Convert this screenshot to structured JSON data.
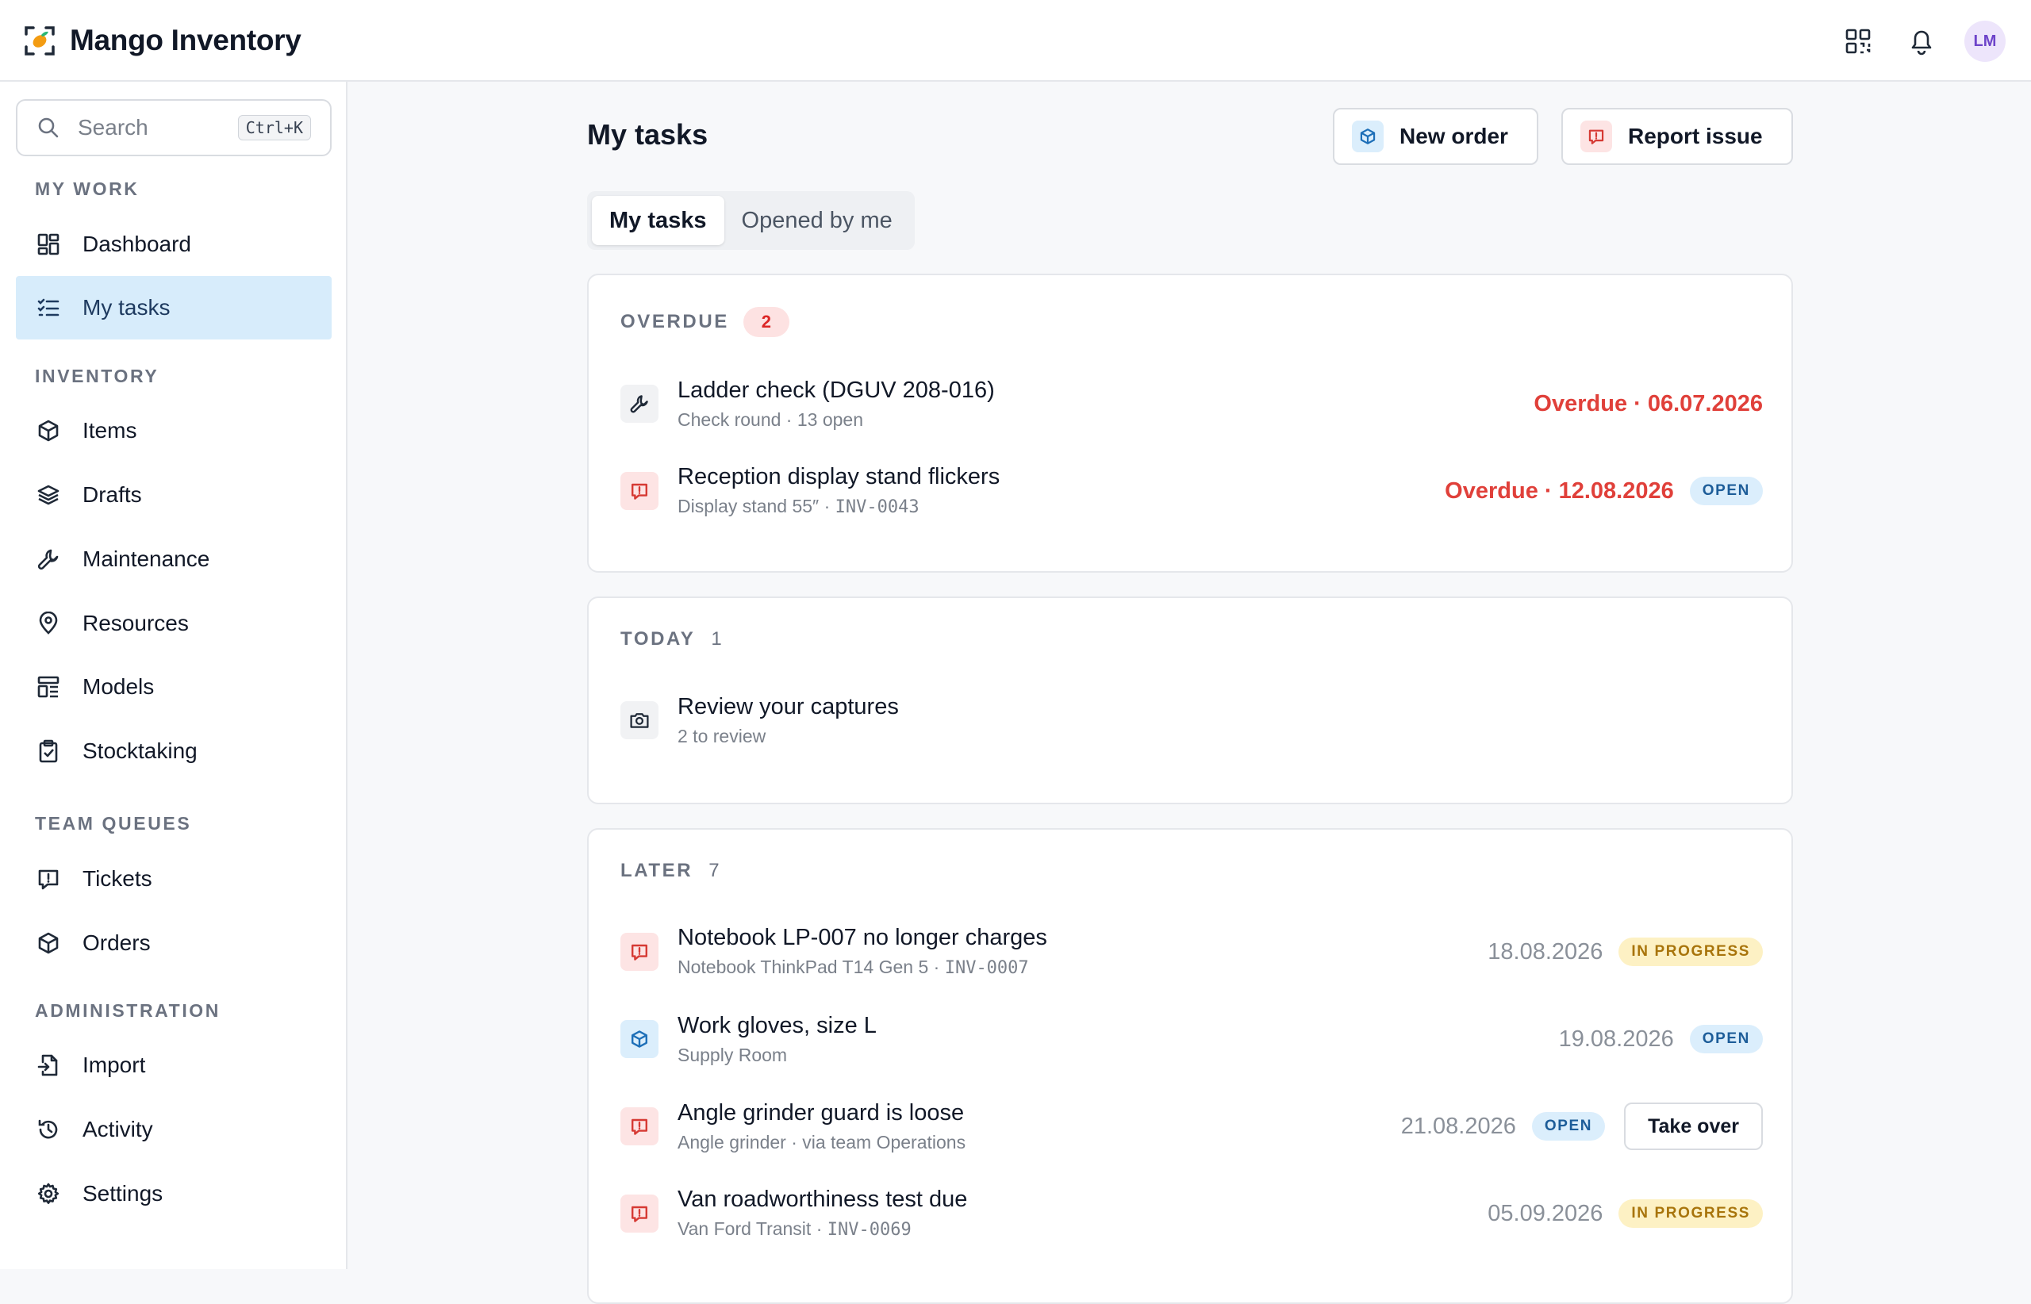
{
  "app": {
    "name": "Mango Inventory",
    "avatar_initials": "LM"
  },
  "topbar": {
    "icons": [
      "qr-code-icon",
      "bell-icon"
    ]
  },
  "sidebar": {
    "search": {
      "placeholder": "Search",
      "shortcut": "Ctrl+K"
    },
    "sections": [
      {
        "title": "MY WORK",
        "items": [
          {
            "label": "Dashboard",
            "icon": "dashboard-icon"
          },
          {
            "label": "My tasks",
            "icon": "tasklist-icon",
            "active": true
          }
        ]
      },
      {
        "title": "INVENTORY",
        "items": [
          {
            "label": "Items",
            "icon": "box-icon"
          },
          {
            "label": "Drafts",
            "icon": "layers-icon"
          },
          {
            "label": "Maintenance",
            "icon": "wrench-icon"
          },
          {
            "label": "Resources",
            "icon": "location-pin-icon"
          },
          {
            "label": "Models",
            "icon": "template-icon"
          },
          {
            "label": "Stocktaking",
            "icon": "clipboard-check-icon"
          }
        ]
      },
      {
        "title": "TEAM QUEUES",
        "items": [
          {
            "label": "Tickets",
            "icon": "message-alert-icon"
          },
          {
            "label": "Orders",
            "icon": "box-icon"
          }
        ]
      },
      {
        "title": "ADMINISTRATION",
        "items": [
          {
            "label": "Import",
            "icon": "file-import-icon"
          },
          {
            "label": "Activity",
            "icon": "history-icon"
          },
          {
            "label": "Settings",
            "icon": "gear-icon"
          }
        ]
      }
    ]
  },
  "main": {
    "title": "My tasks",
    "actions": {
      "new_order": "New order",
      "report_issue": "Report issue"
    },
    "tabs": [
      {
        "label": "My tasks",
        "active": true
      },
      {
        "label": "Opened by me",
        "active": false
      }
    ],
    "groups": {
      "overdue": {
        "label": "OVERDUE",
        "count": "2",
        "tasks": [
          {
            "title": "Ladder check (DGUV 208-016)",
            "subtitle": "Check round · 13 open",
            "due": "Overdue · 06.07.2026",
            "icon": "wrench-icon"
          },
          {
            "title": "Reception display stand flickers",
            "subtitle_text": "Display stand 55″ · ",
            "subtitle_code": "INV-0043",
            "due": "Overdue · 12.08.2026",
            "status": "OPEN",
            "icon": "message-alert-icon"
          }
        ]
      },
      "today": {
        "label": "TODAY",
        "count": "1",
        "tasks": [
          {
            "title": "Review your captures",
            "subtitle": "2 to review",
            "icon": "camera-icon"
          }
        ]
      },
      "later": {
        "label": "LATER",
        "count": "7",
        "tasks": [
          {
            "title": "Notebook LP-007 no longer charges",
            "subtitle_text": "Notebook ThinkPad T14 Gen 5 · ",
            "subtitle_code": "INV-0007",
            "due": "18.08.2026",
            "status": "IN PROGRESS",
            "icon": "message-alert-icon"
          },
          {
            "title": "Work gloves, size L",
            "subtitle": "Supply Room",
            "due": "19.08.2026",
            "status": "OPEN",
            "icon": "box-icon"
          },
          {
            "title": "Angle grinder guard is loose",
            "subtitle": "Angle grinder · via team Operations",
            "due": "21.08.2026",
            "status": "OPEN",
            "action": "Take over",
            "icon": "message-alert-icon"
          },
          {
            "title": "Van roadworthiness test due",
            "subtitle_text": "Van Ford Transit · ",
            "subtitle_code": "INV-0069",
            "due": "05.09.2026",
            "status": "IN PROGRESS",
            "icon": "message-alert-icon"
          }
        ]
      }
    }
  },
  "colors": {
    "accent_active": "#d7ecfb",
    "overdue": "#e0403a",
    "open_pill": "#1d5d99",
    "progress_pill": "#a8740b",
    "brand_orange": "#f39c12"
  }
}
